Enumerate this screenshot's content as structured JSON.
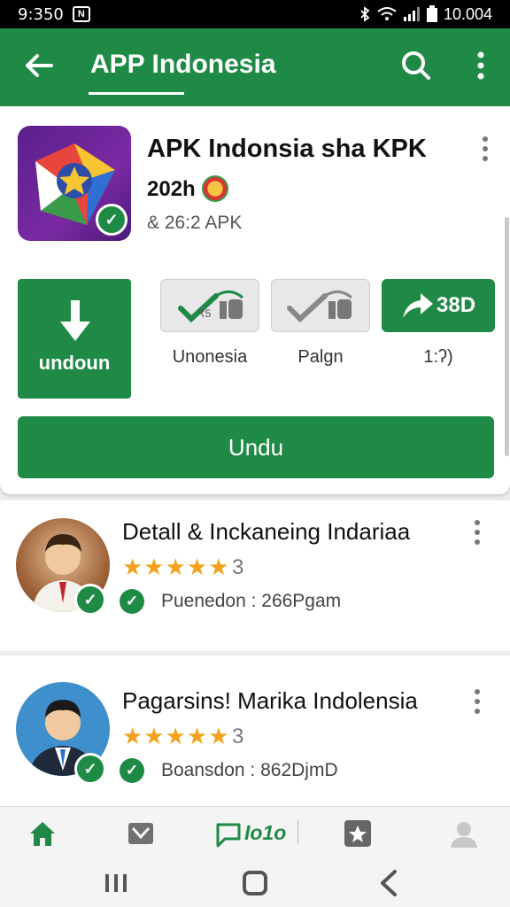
{
  "status": {
    "time": "9:350",
    "notification_icon": "N",
    "battery_text": "10.004"
  },
  "appbar": {
    "title": "APP Indonesia",
    "icons": [
      "back-arrow-icon",
      "search-icon",
      "more-vert-icon"
    ]
  },
  "app": {
    "name": "APK Indonsia sha KPK",
    "year": "202h",
    "subtitle": "& 26:2 APK",
    "download_label": "undoun",
    "actions": [
      {
        "label": "Unonesia"
      },
      {
        "label": "Palgn"
      }
    ],
    "share": {
      "value": "38D",
      "label": "1:ʔ)"
    },
    "primary_button": "Undu"
  },
  "list": [
    {
      "title": "Detall & Inckaneing Indariaa",
      "stars": "★★★★★",
      "rating": "3",
      "meta": "Puenedon  : 266Pgam"
    },
    {
      "title": "Pagarsins! Marika Indolensia",
      "stars": "★★★★★",
      "rating": "3",
      "meta": "Boansdon  : 862DjmD"
    }
  ],
  "bottom_nav": {
    "center_label": "Io1o",
    "icons": [
      "home-icon",
      "inbox-icon",
      "chat-icon",
      "star-icon",
      "profile-icon"
    ]
  },
  "colors": {
    "primary": "#1e8a45",
    "star": "#f2a21c"
  }
}
